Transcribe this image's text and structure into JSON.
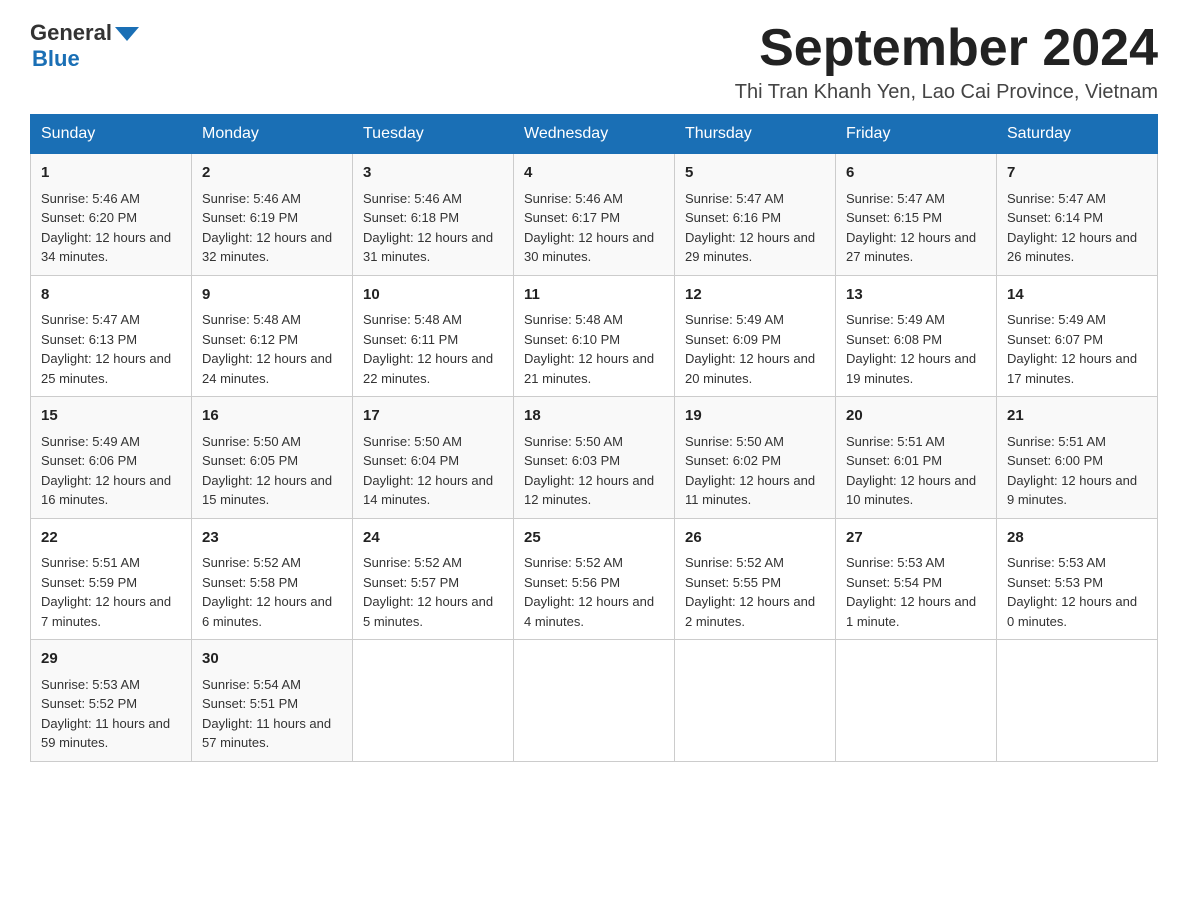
{
  "header": {
    "logo_general": "General",
    "logo_blue": "Blue",
    "month_title": "September 2024",
    "location": "Thi Tran Khanh Yen, Lao Cai Province, Vietnam"
  },
  "days_of_week": [
    "Sunday",
    "Monday",
    "Tuesday",
    "Wednesday",
    "Thursday",
    "Friday",
    "Saturday"
  ],
  "weeks": [
    [
      {
        "day": "1",
        "sunrise": "Sunrise: 5:46 AM",
        "sunset": "Sunset: 6:20 PM",
        "daylight": "Daylight: 12 hours and 34 minutes."
      },
      {
        "day": "2",
        "sunrise": "Sunrise: 5:46 AM",
        "sunset": "Sunset: 6:19 PM",
        "daylight": "Daylight: 12 hours and 32 minutes."
      },
      {
        "day": "3",
        "sunrise": "Sunrise: 5:46 AM",
        "sunset": "Sunset: 6:18 PM",
        "daylight": "Daylight: 12 hours and 31 minutes."
      },
      {
        "day": "4",
        "sunrise": "Sunrise: 5:46 AM",
        "sunset": "Sunset: 6:17 PM",
        "daylight": "Daylight: 12 hours and 30 minutes."
      },
      {
        "day": "5",
        "sunrise": "Sunrise: 5:47 AM",
        "sunset": "Sunset: 6:16 PM",
        "daylight": "Daylight: 12 hours and 29 minutes."
      },
      {
        "day": "6",
        "sunrise": "Sunrise: 5:47 AM",
        "sunset": "Sunset: 6:15 PM",
        "daylight": "Daylight: 12 hours and 27 minutes."
      },
      {
        "day": "7",
        "sunrise": "Sunrise: 5:47 AM",
        "sunset": "Sunset: 6:14 PM",
        "daylight": "Daylight: 12 hours and 26 minutes."
      }
    ],
    [
      {
        "day": "8",
        "sunrise": "Sunrise: 5:47 AM",
        "sunset": "Sunset: 6:13 PM",
        "daylight": "Daylight: 12 hours and 25 minutes."
      },
      {
        "day": "9",
        "sunrise": "Sunrise: 5:48 AM",
        "sunset": "Sunset: 6:12 PM",
        "daylight": "Daylight: 12 hours and 24 minutes."
      },
      {
        "day": "10",
        "sunrise": "Sunrise: 5:48 AM",
        "sunset": "Sunset: 6:11 PM",
        "daylight": "Daylight: 12 hours and 22 minutes."
      },
      {
        "day": "11",
        "sunrise": "Sunrise: 5:48 AM",
        "sunset": "Sunset: 6:10 PM",
        "daylight": "Daylight: 12 hours and 21 minutes."
      },
      {
        "day": "12",
        "sunrise": "Sunrise: 5:49 AM",
        "sunset": "Sunset: 6:09 PM",
        "daylight": "Daylight: 12 hours and 20 minutes."
      },
      {
        "day": "13",
        "sunrise": "Sunrise: 5:49 AM",
        "sunset": "Sunset: 6:08 PM",
        "daylight": "Daylight: 12 hours and 19 minutes."
      },
      {
        "day": "14",
        "sunrise": "Sunrise: 5:49 AM",
        "sunset": "Sunset: 6:07 PM",
        "daylight": "Daylight: 12 hours and 17 minutes."
      }
    ],
    [
      {
        "day": "15",
        "sunrise": "Sunrise: 5:49 AM",
        "sunset": "Sunset: 6:06 PM",
        "daylight": "Daylight: 12 hours and 16 minutes."
      },
      {
        "day": "16",
        "sunrise": "Sunrise: 5:50 AM",
        "sunset": "Sunset: 6:05 PM",
        "daylight": "Daylight: 12 hours and 15 minutes."
      },
      {
        "day": "17",
        "sunrise": "Sunrise: 5:50 AM",
        "sunset": "Sunset: 6:04 PM",
        "daylight": "Daylight: 12 hours and 14 minutes."
      },
      {
        "day": "18",
        "sunrise": "Sunrise: 5:50 AM",
        "sunset": "Sunset: 6:03 PM",
        "daylight": "Daylight: 12 hours and 12 minutes."
      },
      {
        "day": "19",
        "sunrise": "Sunrise: 5:50 AM",
        "sunset": "Sunset: 6:02 PM",
        "daylight": "Daylight: 12 hours and 11 minutes."
      },
      {
        "day": "20",
        "sunrise": "Sunrise: 5:51 AM",
        "sunset": "Sunset: 6:01 PM",
        "daylight": "Daylight: 12 hours and 10 minutes."
      },
      {
        "day": "21",
        "sunrise": "Sunrise: 5:51 AM",
        "sunset": "Sunset: 6:00 PM",
        "daylight": "Daylight: 12 hours and 9 minutes."
      }
    ],
    [
      {
        "day": "22",
        "sunrise": "Sunrise: 5:51 AM",
        "sunset": "Sunset: 5:59 PM",
        "daylight": "Daylight: 12 hours and 7 minutes."
      },
      {
        "day": "23",
        "sunrise": "Sunrise: 5:52 AM",
        "sunset": "Sunset: 5:58 PM",
        "daylight": "Daylight: 12 hours and 6 minutes."
      },
      {
        "day": "24",
        "sunrise": "Sunrise: 5:52 AM",
        "sunset": "Sunset: 5:57 PM",
        "daylight": "Daylight: 12 hours and 5 minutes."
      },
      {
        "day": "25",
        "sunrise": "Sunrise: 5:52 AM",
        "sunset": "Sunset: 5:56 PM",
        "daylight": "Daylight: 12 hours and 4 minutes."
      },
      {
        "day": "26",
        "sunrise": "Sunrise: 5:52 AM",
        "sunset": "Sunset: 5:55 PM",
        "daylight": "Daylight: 12 hours and 2 minutes."
      },
      {
        "day": "27",
        "sunrise": "Sunrise: 5:53 AM",
        "sunset": "Sunset: 5:54 PM",
        "daylight": "Daylight: 12 hours and 1 minute."
      },
      {
        "day": "28",
        "sunrise": "Sunrise: 5:53 AM",
        "sunset": "Sunset: 5:53 PM",
        "daylight": "Daylight: 12 hours and 0 minutes."
      }
    ],
    [
      {
        "day": "29",
        "sunrise": "Sunrise: 5:53 AM",
        "sunset": "Sunset: 5:52 PM",
        "daylight": "Daylight: 11 hours and 59 minutes."
      },
      {
        "day": "30",
        "sunrise": "Sunrise: 5:54 AM",
        "sunset": "Sunset: 5:51 PM",
        "daylight": "Daylight: 11 hours and 57 minutes."
      },
      null,
      null,
      null,
      null,
      null
    ]
  ]
}
